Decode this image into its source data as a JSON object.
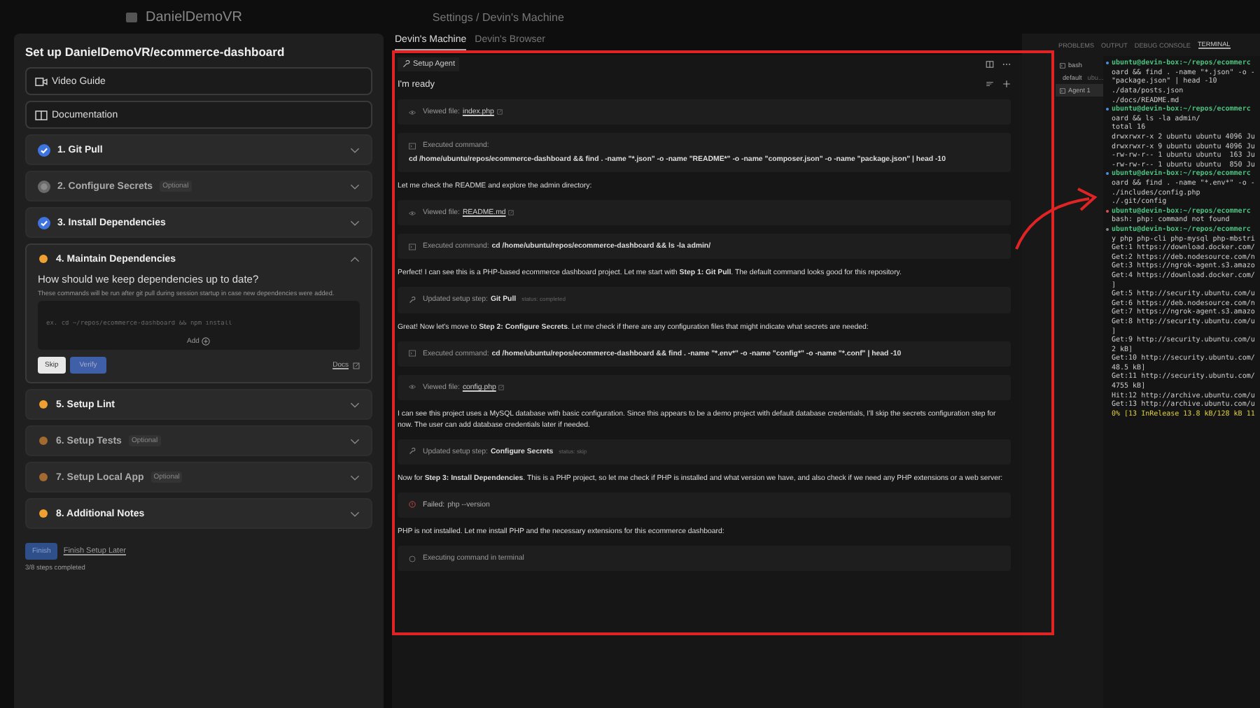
{
  "top_bar": {
    "workspace": "DanielDemoVR",
    "breadcrumb": "Settings / Devin's Machine"
  },
  "setup": {
    "title": "Set up DanielDemoVR/ecommerce-dashboard",
    "links": [
      {
        "label": "Video Guide",
        "kind": "video"
      },
      {
        "label": "Documentation",
        "kind": "docs"
      }
    ],
    "steps": [
      {
        "label": "1. Git Pull",
        "completed": true,
        "skipped": false,
        "expanded": false
      },
      {
        "label": "2. Configure Secrets",
        "completed": false,
        "skipped": true,
        "tag": "Optional",
        "expanded": false
      },
      {
        "label": "3. Install Dependencies",
        "completed": true,
        "skipped": false,
        "expanded": false
      },
      {
        "label": "4. Maintain Dependencies",
        "completed": false,
        "skipped": false,
        "expanded": true
      },
      {
        "label": "5. Setup Lint",
        "completed": false,
        "skipped": false,
        "expanded": false
      },
      {
        "label": "6. Setup Tests",
        "completed": false,
        "skipped": false,
        "tag": "Optional",
        "expanded": false
      },
      {
        "label": "7. Setup Local App",
        "completed": false,
        "skipped": false,
        "tag": "Optional",
        "expanded": false
      },
      {
        "label": "8. Additional Notes",
        "completed": false,
        "skipped": false,
        "expanded": false
      }
    ],
    "detail": {
      "question": "How should we keep dependencies up to date?",
      "hint": "These commands will be run after git pull during session startup in case new dependencies were added.",
      "placeholder": "ex. cd ~/repos/ecommerce-dashboard && npm install",
      "add": "Add",
      "skip": "Skip",
      "verify": "Verify",
      "docs": "Docs"
    },
    "finish": "Finish",
    "later": "Finish Setup Later",
    "progress": "3/8 steps completed"
  },
  "panel_tabs": [
    {
      "label": "Devin's Machine",
      "selected": true
    },
    {
      "label": "Devin's Browser",
      "selected": false
    }
  ],
  "agent": {
    "tab": "Setup Agent",
    "status": "I'm ready",
    "messages": [
      {
        "kind": "view",
        "label": "Viewed file:",
        "target": "index.php",
        "link": true
      },
      {
        "kind": "command",
        "label": "Executed command:",
        "target": "cd /home/ubuntu/repos/ecommerce-dashboard && find . -name \"*.json\" -o -name \"README*\" -o -name \"composer.json\" -o -name \"package.json\" | head -10",
        "link": false
      },
      {
        "kind": "text",
        "text": "Let me check the README and explore the admin directory:"
      },
      {
        "kind": "view",
        "label": "Viewed file:",
        "target": "README.md",
        "link": true
      },
      {
        "kind": "command",
        "label": "Executed command:",
        "target": "cd /home/ubuntu/repos/ecommerce-dashboard && ls -la admin/",
        "link": false
      },
      {
        "kind": "text",
        "text": "Perfect! I can see this is a PHP-based ecommerce dashboard project. Let me start with **Step 1: Git Pull**. The default command looks good for this repository."
      },
      {
        "kind": "update",
        "label": "Updated setup step:",
        "target": "Git Pull",
        "status": "status: completed",
        "link": false
      },
      {
        "kind": "text",
        "text": "Great! Now let's move to **Step 2: Configure Secrets**. Let me check if there are any configuration files that might indicate what secrets are needed:"
      },
      {
        "kind": "command",
        "label": "Executed command:",
        "target": "cd /home/ubuntu/repos/ecommerce-dashboard && find . -name \"*.env*\" -o -name \"config*\" -o -name \"*.conf\" | head -10",
        "link": false
      },
      {
        "kind": "view",
        "label": "Viewed file:",
        "target": "config.php",
        "link": true
      },
      {
        "kind": "text",
        "text": "I can see this project uses a MySQL database with basic configuration. Since this appears to be a demo project with default database credentials, I'll skip the secrets configuration step for now. The user can add database credentials later if needed."
      },
      {
        "kind": "update",
        "label": "Updated setup step:",
        "target": "Configure Secrets",
        "status": "status: skip",
        "link": false
      },
      {
        "kind": "text",
        "text": "Now for **Step 3: Install Dependencies**. This is a PHP project, so let me check if PHP is installed and what version we have, and also check if we need any PHP extensions or a web server:"
      },
      {
        "kind": "failed",
        "label": "Failed:",
        "target": "php --version",
        "link": false
      },
      {
        "kind": "text",
        "text": "PHP is not installed. Let me install PHP and the necessary extensions for this ecommerce dashboard:"
      },
      {
        "kind": "running",
        "label": "Executing command in terminal",
        "link": false
      }
    ]
  },
  "terminal": {
    "tabs": [
      {
        "label": "PROBLEMS",
        "selected": false
      },
      {
        "label": "OUTPUT",
        "selected": false
      },
      {
        "label": "DEBUG CONSOLE",
        "selected": false
      },
      {
        "label": "TERMINAL",
        "selected": true
      }
    ],
    "sessions": [
      {
        "label": "bash",
        "selected": false,
        "kind": "shell"
      },
      {
        "label": "default",
        "detail": "ubu...",
        "selected": false,
        "kind": "gear"
      },
      {
        "label": "Agent 1",
        "selected": true,
        "kind": "shell"
      }
    ],
    "lines": [
      {
        "kind": "prompt",
        "text": "ubuntu@devin-box:~/repos/ecommerc",
        "color": "#4a8fe0"
      },
      {
        "kind": "out",
        "text": "oard && find . -name \"*.json\" -o -"
      },
      {
        "kind": "out",
        "text": "\"package.json\" | head -10"
      },
      {
        "kind": "out",
        "text": "./data/posts.json"
      },
      {
        "kind": "out",
        "text": "./docs/README.md"
      },
      {
        "kind": "prompt",
        "text": "ubuntu@devin-box:~/repos/ecommerc",
        "color": "#4a8fe0"
      },
      {
        "kind": "out",
        "text": "oard && ls -la admin/"
      },
      {
        "kind": "out",
        "text": "total 16"
      },
      {
        "kind": "out",
        "text": "drwxrwxr-x 2 ubuntu ubuntu 4096 Ju"
      },
      {
        "kind": "out",
        "text": "drwxrwxr-x 9 ubuntu ubuntu 4096 Ju"
      },
      {
        "kind": "out",
        "text": "-rw-rw-r-- 1 ubuntu ubuntu  163 Ju"
      },
      {
        "kind": "out",
        "text": "-rw-rw-r-- 1 ubuntu ubuntu  850 Ju"
      },
      {
        "kind": "prompt",
        "text": "ubuntu@devin-box:~/repos/ecommerc",
        "color": "#4a8fe0"
      },
      {
        "kind": "out",
        "text": "oard && find . -name \"*.env*\" -o -"
      },
      {
        "kind": "out",
        "text": "./includes/config.php"
      },
      {
        "kind": "out",
        "text": "./.git/config"
      },
      {
        "kind": "prompt",
        "text": "ubuntu@devin-box:~/repos/ecommerc",
        "color": "#e05050"
      },
      {
        "kind": "out",
        "text": "bash: php: command not found"
      },
      {
        "kind": "prompt",
        "text": "ubuntu@devin-box:~/repos/ecommerc",
        "color": "#888888"
      },
      {
        "kind": "out",
        "text": "y php php-cli php-mysql php-mbstri"
      },
      {
        "kind": "out",
        "text": "Get:1 https://download.docker.com/"
      },
      {
        "kind": "out",
        "text": "Get:2 https://deb.nodesource.com/n"
      },
      {
        "kind": "out",
        "text": "Get:3 https://ngrok-agent.s3.amazo"
      },
      {
        "kind": "out",
        "text": "Get:4 https://download.docker.com/"
      },
      {
        "kind": "out",
        "text": "]"
      },
      {
        "kind": "out",
        "text": "Get:5 http://security.ubuntu.com/u"
      },
      {
        "kind": "out",
        "text": "Get:6 https://deb.nodesource.com/n"
      },
      {
        "kind": "out",
        "text": "Get:7 https://ngrok-agent.s3.amazo"
      },
      {
        "kind": "out",
        "text": "Get:8 http://security.ubuntu.com/u"
      },
      {
        "kind": "out",
        "text": "]"
      },
      {
        "kind": "out",
        "text": "Get:9 http://security.ubuntu.com/u"
      },
      {
        "kind": "out",
        "text": "2 kB]"
      },
      {
        "kind": "out",
        "text": "Get:10 http://security.ubuntu.com/"
      },
      {
        "kind": "out",
        "text": "48.5 kB]"
      },
      {
        "kind": "out",
        "text": "Get:11 http://security.ubuntu.com/"
      },
      {
        "kind": "out",
        "text": "4755 kB]"
      },
      {
        "kind": "out",
        "text": "Hit:12 http://archive.ubuntu.com/u"
      },
      {
        "kind": "out",
        "text": "Get:13 http://archive.ubuntu.com/u"
      },
      {
        "kind": "progress",
        "text": "0% [13 InRelease 13.8 kB/128 kB 11"
      }
    ]
  }
}
